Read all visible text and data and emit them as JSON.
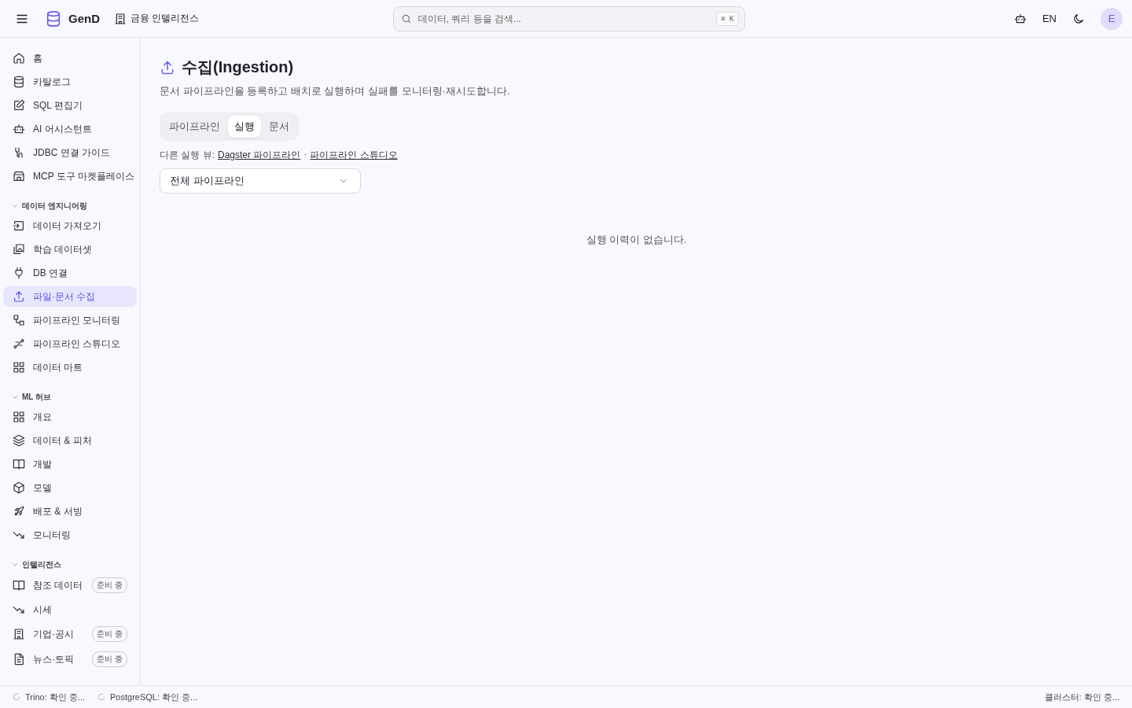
{
  "topbar": {
    "brand": "GenD",
    "workspace": "금융 인텔리전스",
    "search": {
      "placeholder": "데이터, 쿼리 등을 검색...",
      "shortcut": "⌘ K"
    },
    "language": "EN",
    "avatar": "E"
  },
  "sidebar": {
    "items": [
      {
        "label": "홈",
        "selected": false
      },
      {
        "label": "카탈로그",
        "selected": false
      },
      {
        "label": "SQL 편집기",
        "selected": false
      },
      {
        "label": "AI 어시스턴트",
        "selected": false
      },
      {
        "label": "JDBC 연결 가이드",
        "selected": false
      },
      {
        "label": "MCP 도구 마켓플레이스",
        "selected": false
      }
    ],
    "sections": [
      {
        "title": "데이터 엔지니어링",
        "expanded": true,
        "items": [
          {
            "label": "데이터 가져오기",
            "selected": false
          },
          {
            "label": "학습 데이터셋",
            "selected": false
          },
          {
            "label": "DB 연결",
            "selected": false
          },
          {
            "label": "파일·문서 수집",
            "selected": true
          },
          {
            "label": "파이프라인 모니터링",
            "selected": false
          },
          {
            "label": "파이프라인 스튜디오",
            "selected": false
          },
          {
            "label": "데이터 마트",
            "selected": false
          }
        ]
      },
      {
        "title": "ML 허브",
        "expanded": true,
        "items": [
          {
            "label": "개요",
            "selected": false
          },
          {
            "label": "데이터 & 피처",
            "selected": false
          },
          {
            "label": "개발",
            "selected": false
          },
          {
            "label": "모델",
            "selected": false
          },
          {
            "label": "배포 & 서빙",
            "selected": false
          },
          {
            "label": "모니터링",
            "selected": false
          }
        ]
      },
      {
        "title": "인텔리전스",
        "expanded": true,
        "items": [
          {
            "label": "참조 데이터",
            "selected": false,
            "badge": "준비 중"
          },
          {
            "label": "시세",
            "selected": false
          },
          {
            "label": "기업·공시",
            "selected": false,
            "badge": "준비 중"
          },
          {
            "label": "뉴스·토픽",
            "selected": false,
            "badge": "준비 중"
          }
        ]
      }
    ]
  },
  "page": {
    "title": "수집(Ingestion)",
    "description": "문서 파이프라인을 등록하고 배치로 실행하며 실패를 모니터링·재시도합니다.",
    "tabs": [
      {
        "label": "파이프라인",
        "selected": false
      },
      {
        "label": "실행",
        "selected": true
      },
      {
        "label": "문서",
        "selected": false
      }
    ],
    "alt_views": {
      "label": "다른 실행 뷰:",
      "links": [
        "Dagster 파이프라인",
        "파이프라인 스튜디오"
      ],
      "separator": "·"
    },
    "filter": {
      "value": "전체 파이프라인"
    },
    "empty_message": "실행 이력이 없습니다."
  },
  "status_bar": {
    "left": [
      "Trino: 확인 중...",
      "PostgreSQL: 확인 중..."
    ],
    "right": "클러스터: 확인 중..."
  }
}
